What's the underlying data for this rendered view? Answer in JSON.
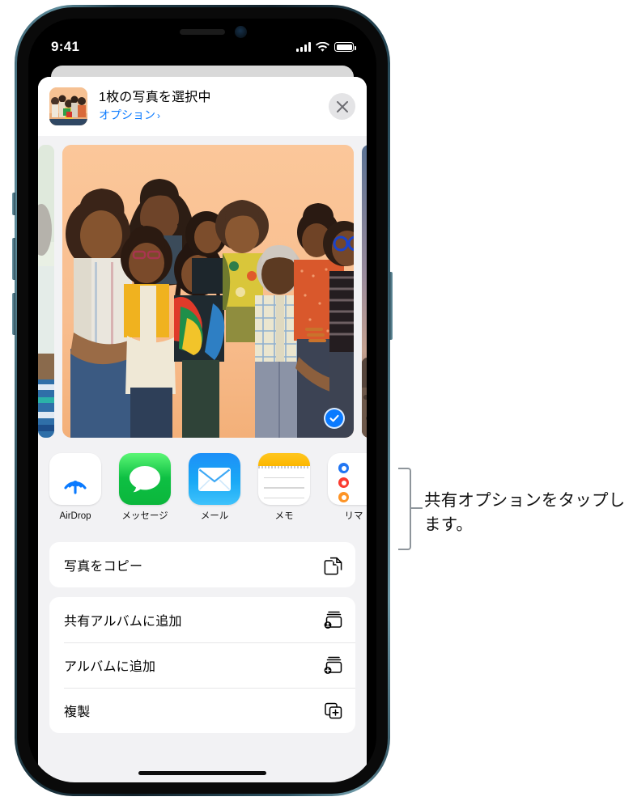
{
  "status_bar": {
    "time": "9:41",
    "cellular_icon": "signal-bars-icon",
    "wifi_icon": "wifi-icon",
    "battery_icon": "battery-icon"
  },
  "share_sheet": {
    "header": {
      "thumbnail_icon": "photo-thumbnail",
      "title": "1枚の写真を選択中",
      "options_link": "オプション",
      "options_chevron": "›",
      "close_icon": "close-icon"
    },
    "carousel": {
      "selected_badge_icon": "checkmark-circle-icon",
      "photos": [
        {
          "name": "previous-photo",
          "visible": "partial-left"
        },
        {
          "name": "selected-photo",
          "visible": "full",
          "selected": true
        },
        {
          "name": "next-photo",
          "visible": "partial-right"
        }
      ]
    },
    "apps": [
      {
        "label": "AirDrop",
        "icon": "airdrop-icon"
      },
      {
        "label": "メッセージ",
        "icon": "messages-icon"
      },
      {
        "label": "メール",
        "icon": "mail-icon"
      },
      {
        "label": "メモ",
        "icon": "notes-icon"
      },
      {
        "label": "リマ",
        "icon": "reminders-icon"
      }
    ],
    "action_groups": [
      {
        "rows": [
          {
            "label": "写真をコピー",
            "icon": "copy-photo-icon"
          }
        ]
      },
      {
        "rows": [
          {
            "label": "共有アルバムに追加",
            "icon": "add-to-shared-album-icon"
          },
          {
            "label": "アルバムに追加",
            "icon": "add-to-album-icon"
          },
          {
            "label": "複製",
            "icon": "duplicate-icon"
          }
        ]
      }
    ]
  },
  "callout": {
    "text": "共有オプションをタップします。",
    "bracket_icon": "callout-bracket"
  },
  "colors": {
    "accent_blue": "#0a7aff",
    "sheet_background": "#f2f2f4",
    "row_background": "#ffffff",
    "callout_gray": "#8e959b"
  }
}
